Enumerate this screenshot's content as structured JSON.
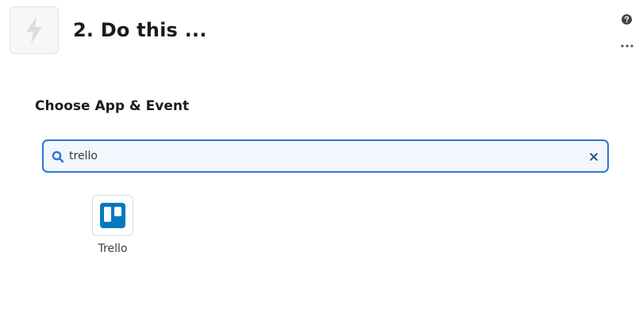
{
  "header": {
    "step_title": "2. Do this ...",
    "step_icon": "lightning-bolt-icon",
    "help_icon": "question-circle-icon",
    "more_icon": "ellipsis-icon"
  },
  "main": {
    "section_heading": "Choose App & Event",
    "search": {
      "value": "trello",
      "search_icon": "search-icon",
      "clear_icon": "close-icon"
    },
    "results": [
      {
        "label": "Trello",
        "icon": "trello-icon"
      }
    ]
  },
  "colors": {
    "accent": "#2d74da",
    "search_bg": "#f3f6fd",
    "trello_blue": "#0079bf"
  }
}
